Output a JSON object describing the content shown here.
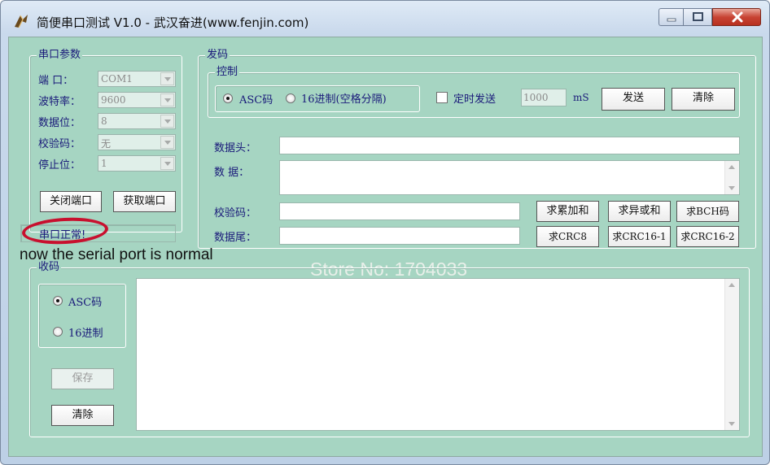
{
  "window": {
    "title": "简便串口测试 V1.0 - 武汉奋进(www.fenjin.com)",
    "buttons": [
      "minimize",
      "maximize",
      "close"
    ],
    "accent": "#a6d5c2"
  },
  "serial_params": {
    "group_title": "串口参数",
    "fields": [
      {
        "label": "端  口：",
        "value": "COM1"
      },
      {
        "label": "波特率：",
        "value": "9600"
      },
      {
        "label": "数据位：",
        "value": "8"
      },
      {
        "label": "校验码：",
        "value": "无"
      },
      {
        "label": "停止位：",
        "value": "1"
      }
    ],
    "close_port_label": "关闭端口",
    "get_port_label": "获取端口",
    "status_text": "串口正常!"
  },
  "send": {
    "group_title": "发码",
    "control": {
      "group_title": "控制",
      "radio_asc": "ASC码",
      "radio_hex": "16进制(空格分隔)",
      "timer_label": "定时发送",
      "interval_value": "1000",
      "interval_unit": "mS",
      "send_label": "发送",
      "clear_label": "清除"
    },
    "header_label": "数据头：",
    "data_label": "数  据：",
    "checksum_label": "校验码：",
    "tail_label": "数据尾：",
    "calc_buttons": [
      "求累加和",
      "求异或和",
      "求BCH码",
      "求CRC8",
      "求CRC16-1",
      "求CRC16-2"
    ]
  },
  "receive": {
    "group_title": "收码",
    "radio_asc": "ASC码",
    "radio_hex": "16进制",
    "save_label": "保存",
    "clear_label": "清除"
  },
  "overlay": {
    "annotation": "now the serial port is normal",
    "watermark": "Store No: 1704033",
    "highlight_color": "#c8102e"
  }
}
